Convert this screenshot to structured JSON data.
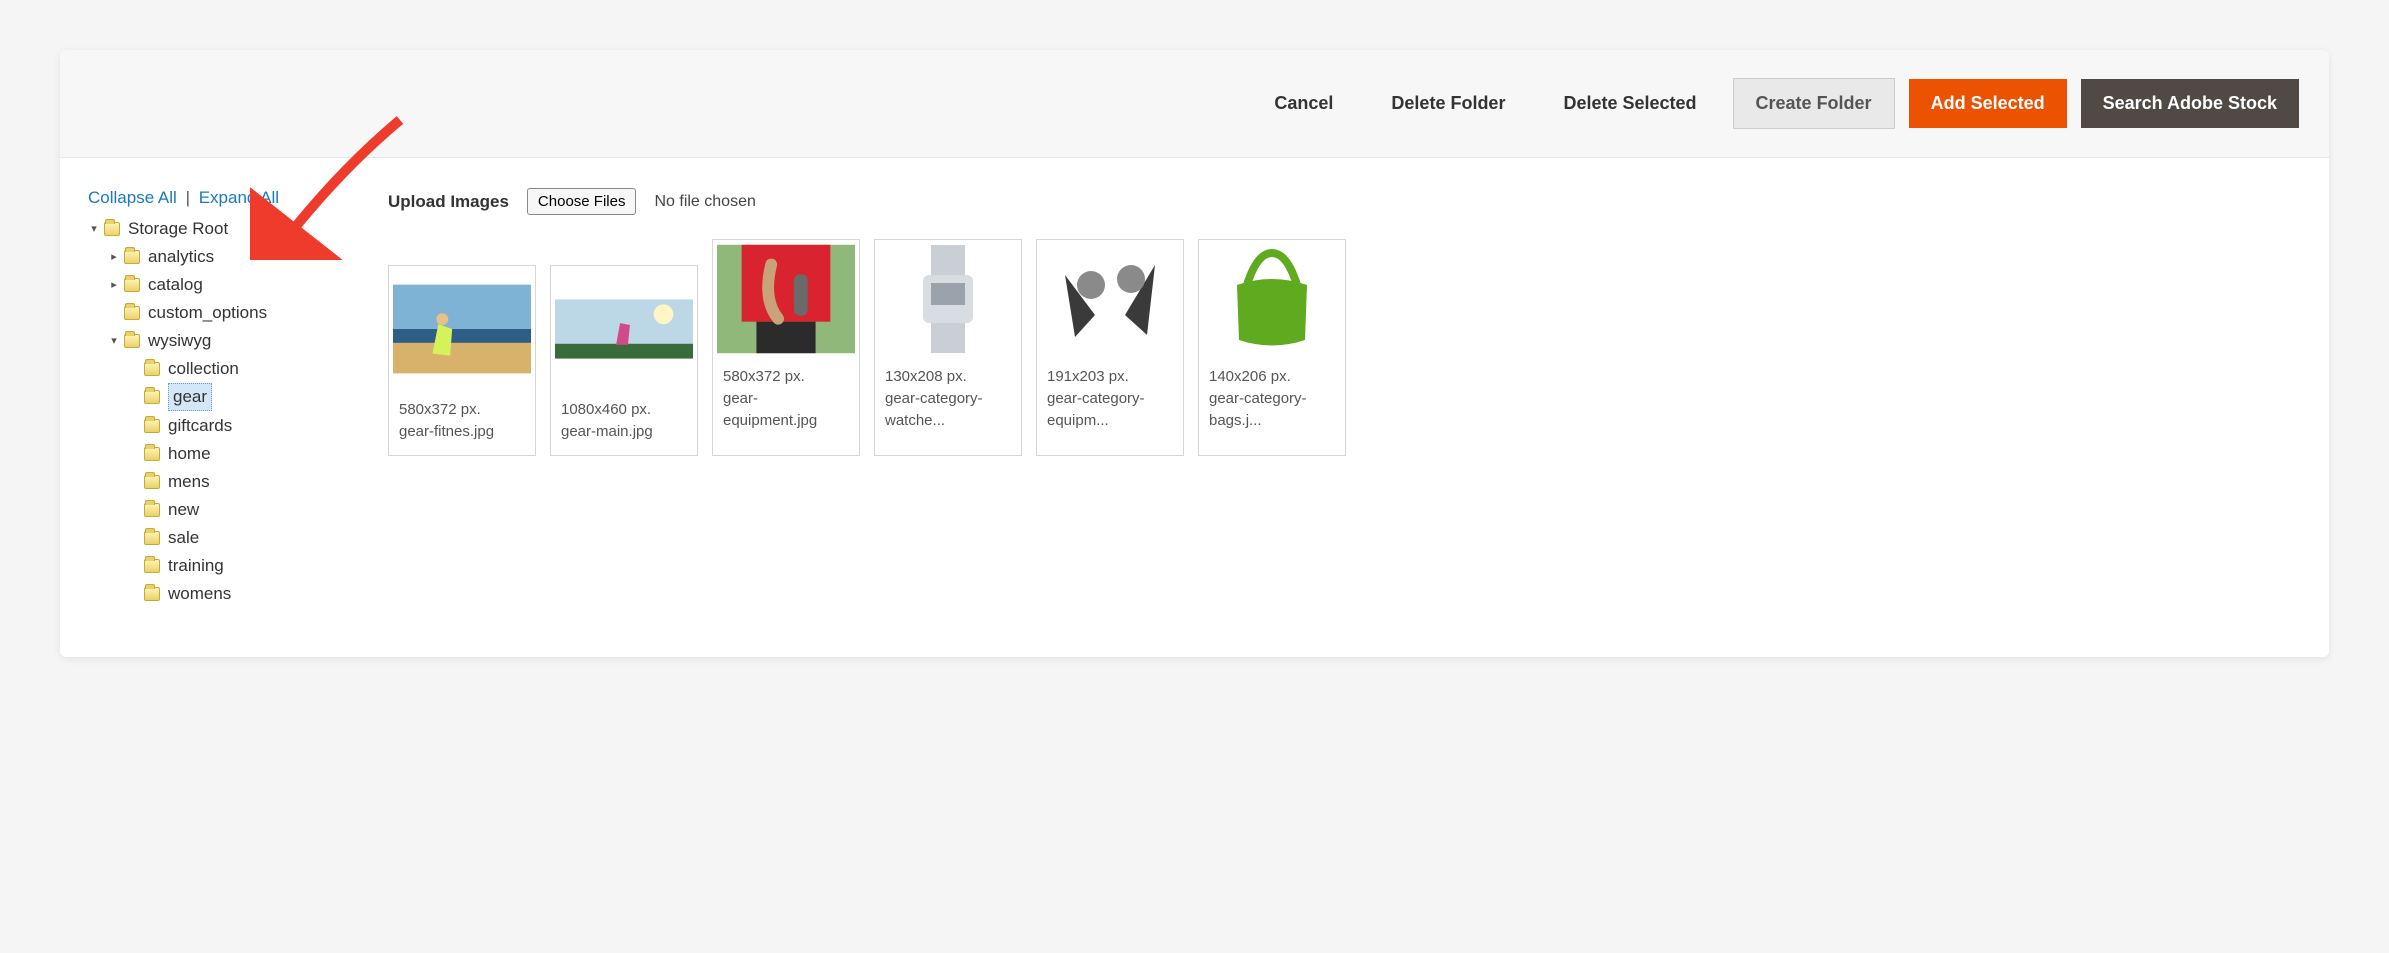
{
  "toolbar": {
    "cancel": "Cancel",
    "delete_folder": "Delete Folder",
    "delete_selected": "Delete Selected",
    "create_folder": "Create Folder",
    "add_selected": "Add Selected",
    "search_adobe": "Search Adobe Stock"
  },
  "tree_actions": {
    "collapse_all": "Collapse All",
    "expand_all": "Expand All",
    "separator": "|"
  },
  "tree": {
    "root": "Storage Root",
    "analytics": "analytics",
    "catalog": "catalog",
    "custom_options": "custom_options",
    "wysiwyg": "wysiwyg",
    "collection": "collection",
    "gear": "gear",
    "giftcards": "giftcards",
    "home": "home",
    "mens": "mens",
    "new": "new",
    "sale": "sale",
    "training": "training",
    "womens": "womens"
  },
  "upload": {
    "label": "Upload Images",
    "button": "Choose Files",
    "status": "No file chosen"
  },
  "thumbs": [
    {
      "dims": "580x372 px.",
      "name": "gear-fitnes.jpg"
    },
    {
      "dims": "1080x460 px.",
      "name": "gear-main.jpg"
    },
    {
      "dims": "580x372 px.",
      "name": "gear-equipment.jpg"
    },
    {
      "dims": "130x208 px.",
      "name": "gear-category-watche..."
    },
    {
      "dims": "191x203 px.",
      "name": "gear-category-equipm..."
    },
    {
      "dims": "140x206 px.",
      "name": "gear-category-bags.j..."
    }
  ]
}
